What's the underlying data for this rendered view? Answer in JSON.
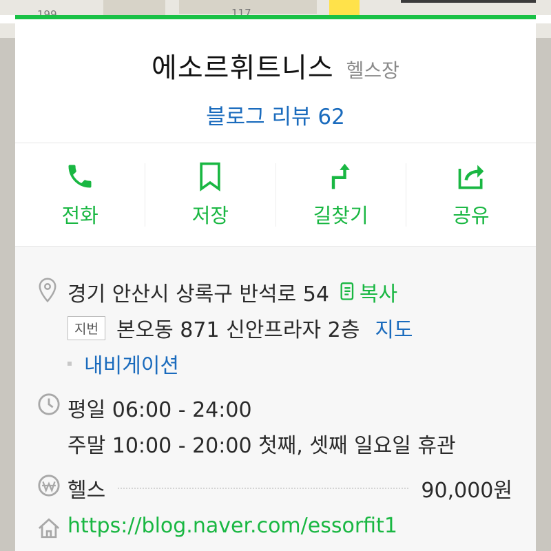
{
  "map": {
    "labels": [
      "199",
      "117"
    ]
  },
  "place": {
    "name": "에소르휘트니스",
    "category": "헬스장",
    "review_link": "블로그 리뷰 62"
  },
  "actions": [
    {
      "label": "전화",
      "icon": "phone-icon"
    },
    {
      "label": "저장",
      "icon": "bookmark-icon"
    },
    {
      "label": "길찾기",
      "icon": "directions-icon"
    },
    {
      "label": "공유",
      "icon": "share-icon"
    }
  ],
  "address": {
    "road": "경기 안산시 상록구 반석로 54",
    "copy_label": "복사",
    "jibun_tag": "지번",
    "jibun": "본오동 871 신안프라자 2층",
    "map_label": "지도",
    "navigation_label": "내비게이션"
  },
  "hours": {
    "weekday": "평일 06:00 - 24:00",
    "weekend": "주말 10:00 - 20:00 첫째, 셋째 일요일 휴관"
  },
  "price": {
    "item": "헬스",
    "amount": "90,000원"
  },
  "website": "https://blog.naver.com/essorfit1",
  "colors": {
    "accent": "#19c146",
    "link": "#1a6bbd",
    "text": "#2a2a2a",
    "muted": "#8a8a8a"
  }
}
